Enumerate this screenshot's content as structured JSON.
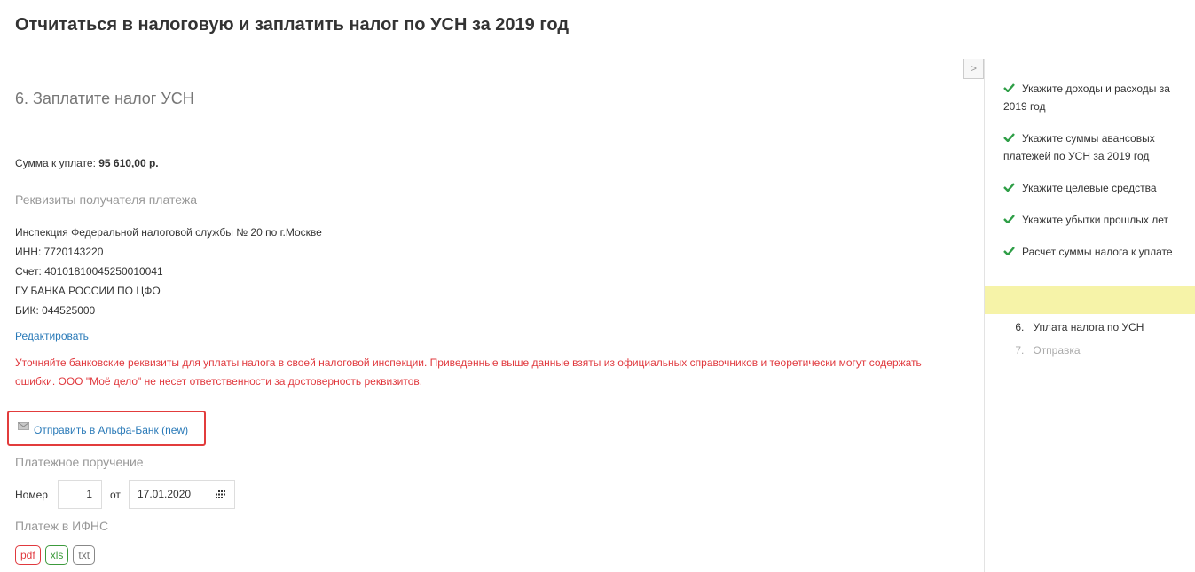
{
  "header": {
    "title": "Отчитаться в налоговую и заплатить налог по УСН за 2019 год"
  },
  "main": {
    "step_title": "6. Заплатите налог УСН",
    "sum_label": "Сумма к уплате: ",
    "sum_value": "95 610,00 р.",
    "recipient_title": "Реквизиты получателя платежа",
    "recipient": {
      "inspection": "Инспекция Федеральной налоговой службы № 20 по г.Москве",
      "inn": "ИНН: 7720143220",
      "account": "Счет: 40101810045250010041",
      "bank": "ГУ БАНКА РОССИИ ПО ЦФО",
      "bik": "БИК: 044525000"
    },
    "edit_label": "Редактировать",
    "warning": "Уточняйте банковские реквизиты для уплаты налога в своей налоговой инспекции. Приведенные выше данные взяты из официальных справочников и теоретически могут содержать ошибки. ООО \"Моё дело\" не несет ответственности за достоверность реквизитов.",
    "alfa_link": "Отправить в Альфа-Банк (new)",
    "payment_order_title": "Платежное поручение",
    "number_label": "Номер",
    "number_value": "1",
    "date_label": "от",
    "date_value": "17.01.2020",
    "ifns_title": "Платеж в ИФНС",
    "files": {
      "pdf": "pdf",
      "xls": "xls",
      "txt": "txt"
    }
  },
  "sidebar": {
    "collapse_label": ">",
    "steps": [
      {
        "label": "Укажите доходы и расходы за 2019 год",
        "state": "done"
      },
      {
        "label": "Укажите суммы авансовых платежей по УСН за 2019 год",
        "state": "done"
      },
      {
        "label": "Укажите целевые средства",
        "state": "done"
      },
      {
        "label": "Укажите убытки прошлых лет",
        "state": "done"
      },
      {
        "label": "Расчет суммы налога к уплате",
        "state": "done"
      },
      {
        "label": "6.   Уплата налога по УСН",
        "state": "active"
      },
      {
        "label": "7.   Отправка",
        "state": "pending"
      }
    ]
  },
  "colors": {
    "accent": "#2a7ab8",
    "warning": "#e0393e",
    "check": "#2e9e46",
    "active_bg": "#f6f3a8"
  }
}
